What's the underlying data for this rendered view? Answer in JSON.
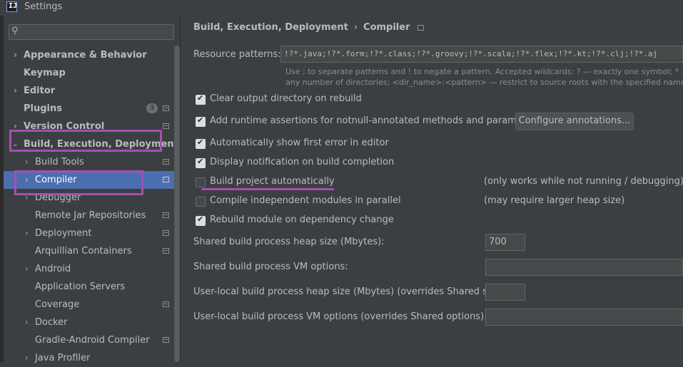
{
  "window": {
    "title": "Settings",
    "app_icon": "IJ"
  },
  "search": {
    "placeholder": "",
    "icon": "search-icon"
  },
  "sidebar": {
    "items": [
      {
        "label": "Appearance & Behavior",
        "bold": true,
        "expandable": true,
        "expanded": false
      },
      {
        "label": "Keymap",
        "bold": true
      },
      {
        "label": "Editor",
        "bold": true,
        "expandable": true,
        "expanded": false
      },
      {
        "label": "Plugins",
        "bold": true,
        "badge": "3"
      },
      {
        "label": "Version Control",
        "bold": true,
        "expandable": true,
        "expanded": false
      },
      {
        "label": "Build, Execution, Deployment",
        "bold": true,
        "expandable": true,
        "expanded": true
      },
      {
        "label": "Build Tools",
        "expandable": true
      },
      {
        "label": "Compiler",
        "expandable": true,
        "selected": true
      },
      {
        "label": "Debugger",
        "expandable": true
      },
      {
        "label": "Remote Jar Repositories"
      },
      {
        "label": "Deployment",
        "expandable": true
      },
      {
        "label": "Arquillian Containers"
      },
      {
        "label": "Android",
        "expandable": true
      },
      {
        "label": "Application Servers"
      },
      {
        "label": "Coverage"
      },
      {
        "label": "Docker",
        "expandable": true
      },
      {
        "label": "Gradle-Android Compiler"
      },
      {
        "label": "Java Profiler",
        "expandable": true
      }
    ]
  },
  "breadcrumb": {
    "parent": "Build, Execution, Deployment",
    "separator": "›",
    "current": "Compiler"
  },
  "main": {
    "resource_patterns": {
      "label": "Resource patterns:",
      "value": "!?*.java;!?*.form;!?*.class;!?*.groovy;!?*.scala;!?*.flex;!?*.kt;!?*.clj;!?*.aj",
      "hint_line1": "Use ; to separate patterns and ! to negate a pattern. Accepted wildcards: ? — exactly one symbol; * — zero",
      "hint_line2": "any number of directories; <dir_name>:<pattern> — restrict to source roots with the specified name"
    },
    "options": [
      {
        "label": "Clear output directory on rebuild",
        "checked": true
      },
      {
        "label": "Add runtime assertions for notnull-annotated methods and parameters",
        "checked": true
      },
      {
        "label": "Automatically show first error in editor",
        "checked": true
      },
      {
        "label": "Display notification on build completion",
        "checked": true
      },
      {
        "label": "Build project automatically",
        "checked": false,
        "note": "(only works while not running / debugging)"
      },
      {
        "label": "Compile independent modules in parallel",
        "checked": false,
        "note": "(may require larger heap size)"
      },
      {
        "label": "Rebuild module on dependency change",
        "checked": true
      }
    ],
    "configure_button": "Configure annotations...",
    "shared_heap": {
      "label": "Shared build process heap size (Mbytes):",
      "value": "700"
    },
    "shared_vm": {
      "label": "Shared build process VM options:",
      "value": ""
    },
    "user_heap": {
      "label": "User-local build process heap size (Mbytes) (overrides Shared size):",
      "value": ""
    },
    "user_vm": {
      "label": "User-local build process VM options (overrides Shared options):",
      "value": ""
    }
  },
  "colors": {
    "background": "#3c3f41",
    "selection": "#4b6eaf",
    "highlight_annotation": "#a64fb3"
  }
}
